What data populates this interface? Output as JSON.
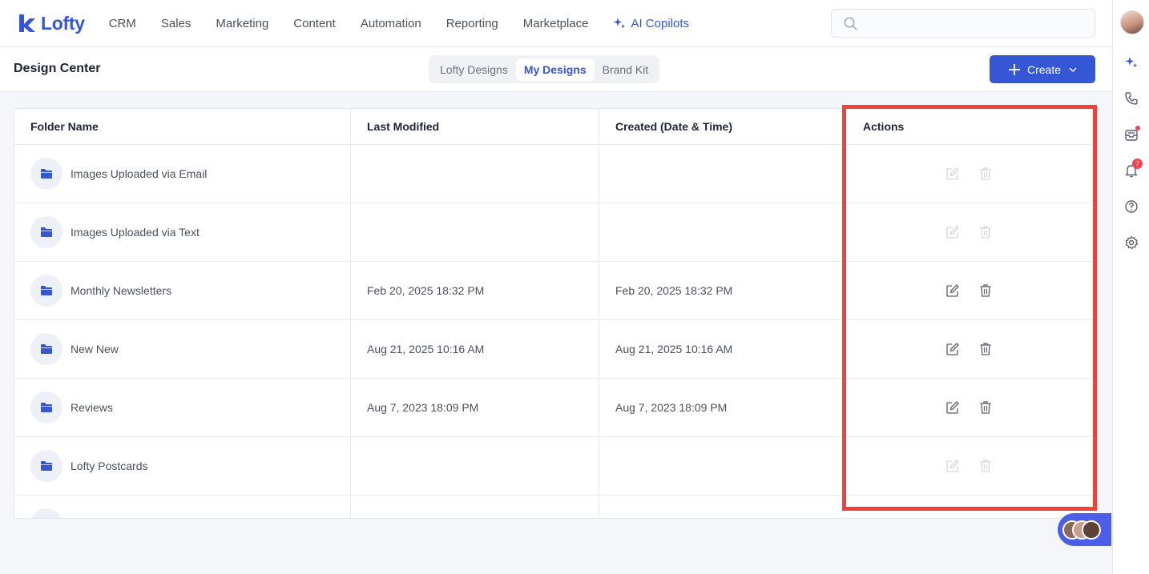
{
  "app": {
    "name": "Lofty",
    "brand_color": "#3557d6"
  },
  "nav": {
    "items": [
      "CRM",
      "Sales",
      "Marketing",
      "Content",
      "Automation",
      "Reporting",
      "Marketplace"
    ],
    "ai_label": "AI Copilots"
  },
  "search": {
    "placeholder": ""
  },
  "subheader": {
    "title": "Design Center",
    "tabs": [
      {
        "label": "Lofty Designs",
        "active": false
      },
      {
        "label": "My Designs",
        "active": true
      },
      {
        "label": "Brand Kit",
        "active": false
      }
    ],
    "create_label": "Create"
  },
  "table": {
    "headers": [
      "Folder Name",
      "Last Modified",
      "Created (Date & Time)",
      "Actions"
    ],
    "rows": [
      {
        "name": "Images Uploaded via Email",
        "modified": "",
        "created": "",
        "actions_enabled": false
      },
      {
        "name": "Images Uploaded via Text",
        "modified": "",
        "created": "",
        "actions_enabled": false
      },
      {
        "name": "Monthly Newsletters",
        "modified": "Feb 20, 2025 18:32 PM",
        "created": "Feb 20, 2025 18:32 PM",
        "actions_enabled": true
      },
      {
        "name": "New New",
        "modified": "Aug 21, 2025 10:16 AM",
        "created": "Aug 21, 2025 10:16 AM",
        "actions_enabled": true
      },
      {
        "name": "Reviews",
        "modified": "Aug 7, 2023 18:09 PM",
        "created": "Aug 7, 2023 18:09 PM",
        "actions_enabled": true
      },
      {
        "name": "Lofty Postcards",
        "modified": "",
        "created": "",
        "actions_enabled": false
      }
    ]
  },
  "rightbar": {
    "notification_count": "7",
    "icons": [
      "sparkle-icon",
      "phone-icon",
      "inbox-icon",
      "bell-icon",
      "help-icon",
      "gear-icon"
    ]
  },
  "colors": {
    "highlight": "#f2413b",
    "chat_bubble": "#4a5ee8"
  }
}
